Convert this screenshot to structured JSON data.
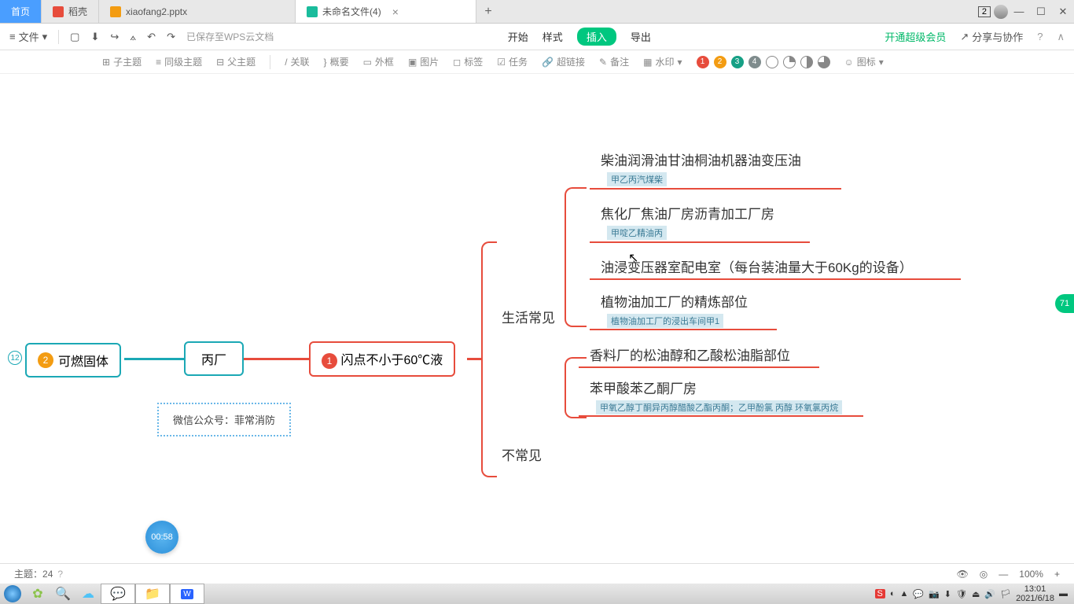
{
  "tabs": {
    "home": "首页",
    "doc": "稻壳",
    "pptx": "xiaofang2.pptx",
    "active": "未命名文件(4)"
  },
  "winBadge": "2",
  "toolbar": {
    "file": "文件",
    "cloud": "已保存至WPS云文档"
  },
  "menus": {
    "start": "开始",
    "style": "样式",
    "insert": "插入",
    "export": "导出",
    "premium": "开通超级会员",
    "share": "分享与协作"
  },
  "ribbon": {
    "sub": "子主题",
    "peer": "同级主题",
    "parent": "父主题",
    "rel": "关联",
    "summary": "概要",
    "frame": "外框",
    "pic": "图片",
    "tag": "标签",
    "task": "任务",
    "link": "超链接",
    "note": "备注",
    "water": "水印",
    "icon": "图标"
  },
  "mindmap": {
    "rootNum": "12",
    "rootBadge": "2",
    "root": "可燃固体",
    "bc": "丙厂",
    "redBadge": "1",
    "red": "闪点不小于60℃液",
    "noteBox": "微信公众号：菲常消防",
    "branch1": "生活常见",
    "branch2": "不常见",
    "leaves": [
      {
        "t": "柴油润滑油甘油桐油机器油变压油",
        "tag": "甲乙丙汽煤柴"
      },
      {
        "t": "焦化厂焦油厂房沥青加工厂房",
        "tag": "甲啶乙精油丙"
      },
      {
        "t": "油浸变压器室配电室（每台装油量大于60Kg的设备）",
        "tag": ""
      },
      {
        "t": "植物油加工厂的精炼部位",
        "tag": "植物油加工厂的浸出车间甲1"
      },
      {
        "t": "香料厂的松油醇和乙酸松油脂部位",
        "tag": ""
      },
      {
        "t": "苯甲酸苯乙酮厂房",
        "tag": "甲氧乙醇丁酮异丙醇醋酸乙酯丙酮；乙甲酚氯   丙醇 环氧氯丙烷"
      }
    ]
  },
  "timer": "00:58",
  "bubble": "71",
  "status": {
    "theme": "主题：",
    "count": "24",
    "zoom": "100%"
  },
  "clock": {
    "time": "13:01",
    "date": "2021/6/18"
  }
}
